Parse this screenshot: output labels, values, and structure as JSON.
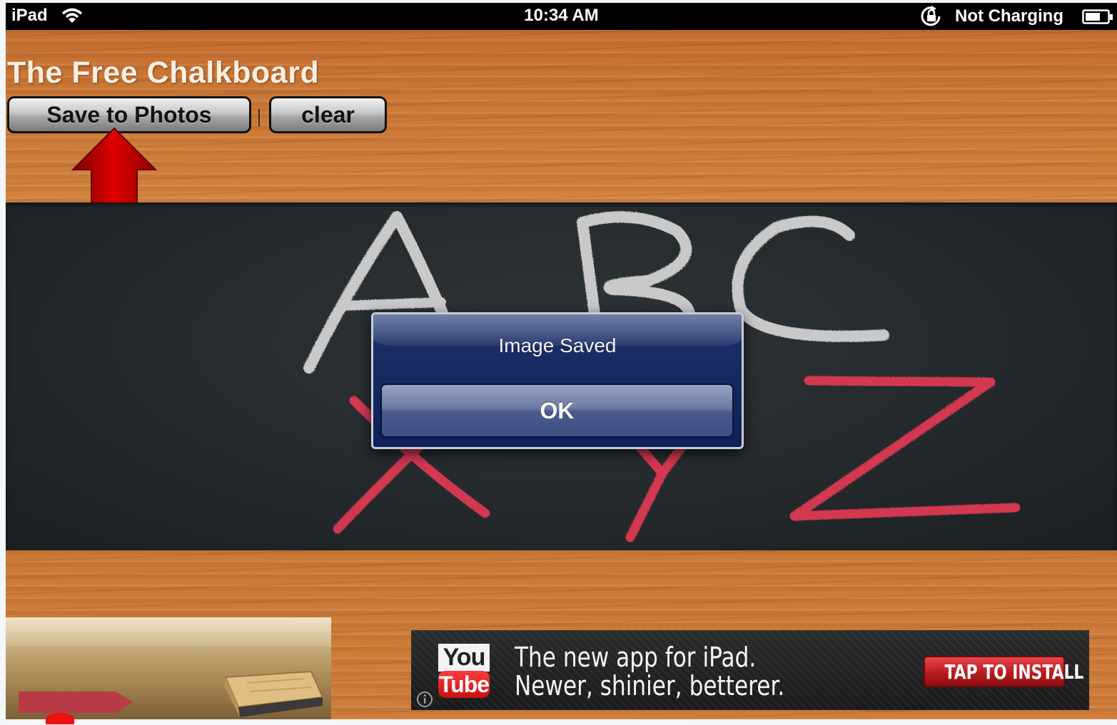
{
  "status_bar": {
    "device": "iPad",
    "time": "10:34 AM",
    "battery_text": "Not Charging"
  },
  "app": {
    "title": "The Free Chalkboard",
    "save_button": "Save to Photos",
    "clear_button": "clear"
  },
  "chalkboard": {
    "top_letters": [
      "A",
      "B",
      "C"
    ],
    "bottom_letters": [
      "X",
      "Y",
      "Z"
    ],
    "top_color": "#c9c9c9",
    "bottom_color": "#d2384f"
  },
  "alert": {
    "title": "Image Saved",
    "ok_label": "OK"
  },
  "ad": {
    "logo_you": "You",
    "logo_tube": "Tube",
    "headline": "The new app for iPad.",
    "subline": "Newer, shinier, betterer.",
    "cta": "TAP TO INSTALL"
  },
  "icons": {
    "wifi": "wifi-icon",
    "rotation_lock": "rotation-lock-icon",
    "battery": "battery-icon",
    "arrow": "red-up-arrow-icon",
    "eraser": "eraser-icon",
    "info": "info-icon"
  },
  "colors": {
    "arrow": "#c00000",
    "alert_bg": "#13235d",
    "wood": "#cd7b38"
  }
}
